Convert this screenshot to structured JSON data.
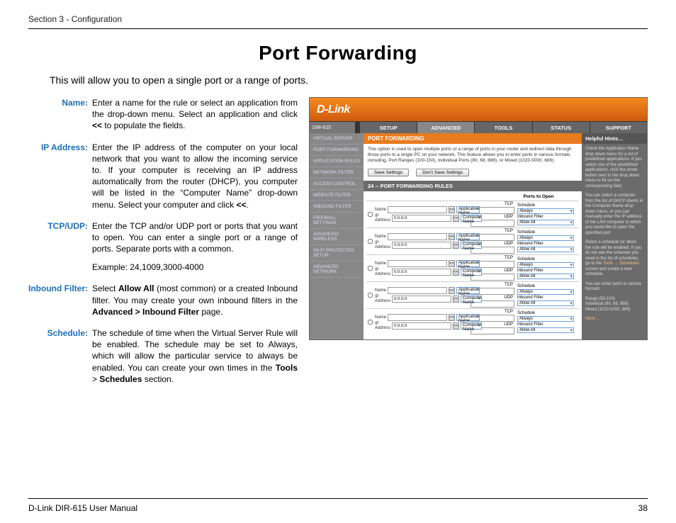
{
  "section_header": "Section 3 - Configuration",
  "page_title": "Port Forwarding",
  "intro": "This will allow you to open a single port or a range of ports.",
  "defs": {
    "name": {
      "label": "Name:",
      "text": "Enter a name for the rule or select an application from the drop-down menu. Select an application and click ",
      "bold1": "<<",
      "text2": " to populate the fields."
    },
    "ip": {
      "label": "IP Address:",
      "text": "Enter the IP address of the computer on your local network that you want to allow the incoming service to. If your computer is receiving an IP address automatically from the router (DHCP), you computer will be listed in the “Computer Name” drop-down menu. Select your computer and click ",
      "bold1": "<<",
      "text2": "."
    },
    "tcpudp": {
      "label": "TCP/UDP:",
      "text": "Enter the TCP and/or UDP port or ports that you want to open. You can enter a single port or a range of ports. Separate ports with a common.",
      "example": "Example: 24,1009,3000-4000"
    },
    "inbound": {
      "label": "Inbound Filter:",
      "text1": "Select ",
      "bold1": "Allow All",
      "text2": " (most common) or a created Inbound filter. You may create your own inbound filters in the ",
      "bold2": "Advanced > Inbound Filter",
      "text3": " page."
    },
    "schedule": {
      "label": "Schedule:",
      "text1": "The schedule of time when the Virtual Server Rule will be enabled. The schedule may be set to Always, which will allow the particular service to always be enabled. You can create your own times in the ",
      "bold1": "Tools",
      "gt": " > ",
      "bold2": "Schedules",
      "text2": " section."
    }
  },
  "screenshot": {
    "logo": "D-Link",
    "model": "DIR-615",
    "tabs": [
      "SETUP",
      "ADVANCED",
      "TOOLS",
      "STATUS",
      "SUPPORT"
    ],
    "active_tab": 1,
    "sidebar": [
      "VIRTUAL SERVER",
      "PORT FORWARDING",
      "APPLICATION RULES",
      "NETWORK FILTER",
      "ACCESS CONTROL",
      "WEBSITE FILTER",
      "INBOUND FILTER",
      "FIREWALL SETTINGS",
      "ADVANCED WIRELESS",
      "WI-FI PROTECTED SETUP",
      "ADVANCED NETWORK"
    ],
    "panel_title": "PORT FORWARDING",
    "panel_desc": "This option is used to open multiple ports or a range of ports in your router and redirect data through those ports to a single PC on your network. This feature allows you to enter ports in various formats including, Port Ranges (100-150), Individual Ports (80, 68, 888), or Mixed (1020-5000, 689).",
    "save_btn": "Save Settings",
    "dont_save_btn": "Don't Save Settings",
    "rules_title": "24 -- PORT FORWARDING RULES",
    "ports_to_open": "Ports to Open",
    "field_name": "Name",
    "field_ip": "IP Address",
    "app_name": "Application Name",
    "comp_name": "Computer Name",
    "ip_default": "0.0.0.0",
    "lt": "<<",
    "tcp": "TCP",
    "udp": "UDP",
    "schedule": "Schedule",
    "always": "Always",
    "inbound_filter": "Inbound Filter",
    "allow_all": "Allow All",
    "hints_title": "Helpful Hints…",
    "hints_p1": "Check the Application Name drop down menu for a list of predefined applications. If you select one of the predefined applications, click the arrow button next to the drop down menu to fill out the corresponding field.",
    "hints_p2": "You can select a computer from the list of DHCP clients in the Computer Name drop down menu, or you can manually enter the IP address of the LAN computer to which you would like to open the specified port.",
    "hints_p3_a": "Select a schedule for when the rule will be enabled. If you do not see the schedule you need in the list of schedules, go to the ",
    "hints_p3_link": "Tools → Schedules",
    "hints_p3_b": " screen and create a new schedule.",
    "hints_p4": "You can enter ports in various formats:",
    "hints_p5": "Range (50-100)\nIndividual (80, 68, 888)\nMixed (1020-5000, 689)",
    "more": "More…"
  },
  "footer": {
    "manual": "D-Link DIR-615 User Manual",
    "page": "38"
  }
}
